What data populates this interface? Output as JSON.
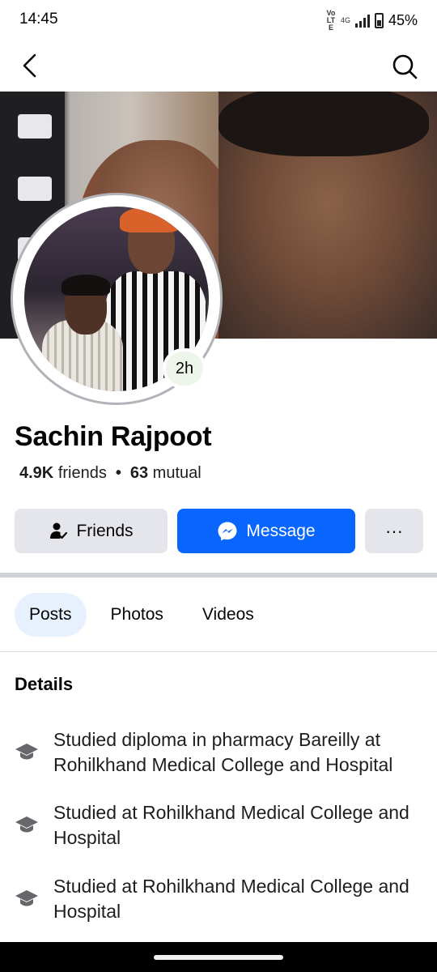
{
  "status_bar": {
    "time": "14:45",
    "volte": "Vo LTE",
    "network": "4G",
    "battery": "45%"
  },
  "nav": {
    "back_icon": "chevron-left-icon",
    "search_icon": "search-icon"
  },
  "profile": {
    "name": "Sachin Rajpoot",
    "story_age": "2h",
    "friends_count": "4.9K",
    "friends_label": "friends",
    "separator": "•",
    "mutual_count": "63",
    "mutual_label": "mutual"
  },
  "actions": {
    "friends_label": "Friends",
    "message_label": "Message",
    "more_label": "···"
  },
  "tabs": [
    {
      "label": "Posts",
      "active": true
    },
    {
      "label": "Photos",
      "active": false
    },
    {
      "label": "Videos",
      "active": false
    }
  ],
  "details": {
    "title": "Details",
    "items": [
      {
        "icon": "graduation-cap-icon",
        "text": "Studied diploma in pharmacy Bareilly at Rohilkhand Medical College and Hospital"
      },
      {
        "icon": "graduation-cap-icon",
        "text": "Studied at Rohilkhand Medical College and Hospital"
      },
      {
        "icon": "graduation-cap-icon",
        "text": "Studied at Rohilkhand Medical College and Hospital"
      }
    ]
  },
  "colors": {
    "accent": "#0866ff",
    "button_gray": "#e4e6eb",
    "tab_active_bg": "#e7f1fd"
  }
}
